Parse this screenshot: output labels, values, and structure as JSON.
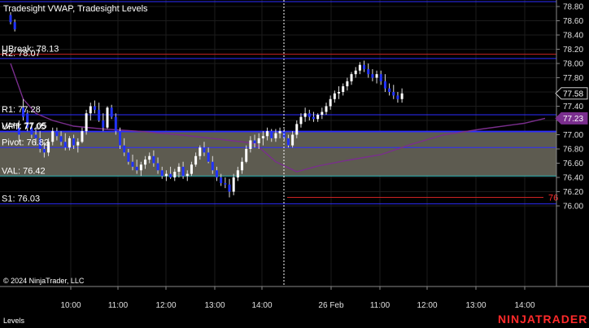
{
  "indicator_title": "Tradesight VWAP, Tradesight Levels",
  "panel_label": "Levels",
  "copyright": "© 2024 NinjaTrader, LLC",
  "brand": "NINJATRADER",
  "colors": {
    "background": "#000000",
    "value_area": "#5d5b50",
    "level_line": "#2d2dff",
    "r2_line": "#cc2222",
    "val_line": "#33bbbb",
    "vwap_line": "#7a2e8e",
    "up_candle": "#ffffff",
    "down_candle": "#2233ff",
    "brand_red": "#ff2a2a"
  },
  "chart_data": {
    "type": "candlestick",
    "ylim": [
      75.98,
      78.86
    ],
    "y_ticks": [
      "78.80",
      "78.60",
      "78.40",
      "78.20",
      "78.00",
      "77.80",
      "77.60",
      "77.40",
      "77.20",
      "77.00",
      "76.80",
      "76.60",
      "76.40",
      "76.20",
      "76.00"
    ],
    "x_ticks": [
      "10:00",
      "11:00",
      "12:00",
      "13:00",
      "14:00",
      "26 Feb",
      "11:00",
      "12:00",
      "13:00",
      "14:00"
    ],
    "levels": [
      {
        "label": "R2: 78.07",
        "value": 78.07,
        "color": "#2d2dff"
      },
      {
        "label": "R1: 77.28",
        "value": 77.28,
        "color": "#2d2dff"
      },
      {
        "label": "VAH: 77.05",
        "value": 77.05,
        "color": "#2d2dff"
      },
      {
        "label": "Pivot: 76.82",
        "value": 76.82,
        "color": "#2d2dff"
      },
      {
        "label": "VAL: 76.42",
        "value": 76.42,
        "color": "#33bbbb"
      },
      {
        "label": "S1: 76.03",
        "value": 76.03,
        "color": "#2d2dff"
      },
      {
        "label": "UPT: 77.05",
        "value": 77.04,
        "color": "#2d2dff"
      }
    ],
    "breakout": {
      "label": "UBreak: 78.13",
      "value": 78.13
    },
    "value_area": [
      76.42,
      77.05
    ],
    "price_badges": [
      {
        "label": "77.58",
        "value": 77.58
      },
      {
        "label": "77.23",
        "value": 77.23
      }
    ],
    "red_marker_label": "76",
    "red_marker_value": 76.12,
    "vwap": [
      [
        0,
        78.0
      ],
      [
        3,
        77.5
      ],
      [
        6,
        77.3
      ],
      [
        10,
        77.2
      ],
      [
        15,
        77.12
      ],
      [
        22,
        77.08
      ],
      [
        30,
        77.05
      ],
      [
        40,
        77.0
      ],
      [
        52,
        76.92
      ],
      [
        58,
        76.88
      ],
      [
        63,
        76.62
      ],
      [
        68,
        76.48
      ],
      [
        73,
        76.56
      ],
      [
        80,
        76.64
      ],
      [
        88,
        76.72
      ],
      [
        95,
        76.86
      ],
      [
        103,
        77.0
      ],
      [
        112,
        77.08
      ],
      [
        122,
        77.16
      ],
      [
        127,
        77.23
      ]
    ],
    "ohlc": [
      [
        78.68,
        78.72,
        78.55,
        78.58
      ],
      [
        78.58,
        78.62,
        78.45,
        78.48
      ],
      [
        77.1,
        77.2,
        76.9,
        77.0
      ],
      [
        77.38,
        77.5,
        77.2,
        77.25
      ],
      [
        77.3,
        77.35,
        77.05,
        77.1
      ],
      [
        77.1,
        77.15,
        76.95,
        77.0
      ],
      [
        77.0,
        77.1,
        76.85,
        76.95
      ],
      [
        76.95,
        77.05,
        76.75,
        76.8
      ],
      [
        76.8,
        76.9,
        76.68,
        76.75
      ],
      [
        76.75,
        76.95,
        76.7,
        76.9
      ],
      [
        76.9,
        77.1,
        76.85,
        77.05
      ],
      [
        77.05,
        77.1,
        76.92,
        76.98
      ],
      [
        76.98,
        77.05,
        76.85,
        76.9
      ],
      [
        76.9,
        77.02,
        76.78,
        76.82
      ],
      [
        76.82,
        76.98,
        76.78,
        76.95
      ],
      [
        76.95,
        77.0,
        76.8,
        76.85
      ],
      [
        76.85,
        76.95,
        76.75,
        76.9
      ],
      [
        76.9,
        77.1,
        76.88,
        77.05
      ],
      [
        77.05,
        77.35,
        77.0,
        77.3
      ],
      [
        77.3,
        77.45,
        77.2,
        77.4
      ],
      [
        77.4,
        77.48,
        77.3,
        77.35
      ],
      [
        77.35,
        77.45,
        77.18,
        77.2
      ],
      [
        77.2,
        77.3,
        77.05,
        77.1
      ],
      [
        77.1,
        77.4,
        77.08,
        77.38
      ],
      [
        77.38,
        77.42,
        77.22,
        77.25
      ],
      [
        77.25,
        77.3,
        77.0,
        77.05
      ],
      [
        77.05,
        77.1,
        76.8,
        76.85
      ],
      [
        76.85,
        76.95,
        76.7,
        76.75
      ],
      [
        76.75,
        76.8,
        76.58,
        76.62
      ],
      [
        76.62,
        76.72,
        76.5,
        76.55
      ],
      [
        76.55,
        76.65,
        76.45,
        76.5
      ],
      [
        76.5,
        76.62,
        76.42,
        76.58
      ],
      [
        76.58,
        76.7,
        76.52,
        76.65
      ],
      [
        76.65,
        76.75,
        76.6,
        76.7
      ],
      [
        76.7,
        76.78,
        76.55,
        76.6
      ],
      [
        76.6,
        76.68,
        76.45,
        76.5
      ],
      [
        76.5,
        76.55,
        76.38,
        76.42
      ],
      [
        76.42,
        76.5,
        76.35,
        76.45
      ],
      [
        76.45,
        76.55,
        76.38,
        76.4
      ],
      [
        76.4,
        76.52,
        76.35,
        76.48
      ],
      [
        76.48,
        76.6,
        76.4,
        76.55
      ],
      [
        76.55,
        76.62,
        76.38,
        76.42
      ],
      [
        76.42,
        76.5,
        76.35,
        76.45
      ],
      [
        76.45,
        76.62,
        76.42,
        76.58
      ],
      [
        76.58,
        76.75,
        76.55,
        76.7
      ],
      [
        76.7,
        76.85,
        76.65,
        76.82
      ],
      [
        76.82,
        76.9,
        76.7,
        76.75
      ],
      [
        76.75,
        76.82,
        76.6,
        76.62
      ],
      [
        76.62,
        76.7,
        76.45,
        76.5
      ],
      [
        76.5,
        76.55,
        76.35,
        76.4
      ],
      [
        76.4,
        76.45,
        76.28,
        76.32
      ],
      [
        76.32,
        76.4,
        76.25,
        76.3
      ],
      [
        76.3,
        76.38,
        76.12,
        76.2
      ],
      [
        76.2,
        76.45,
        76.15,
        76.4
      ],
      [
        76.4,
        76.55,
        76.35,
        76.5
      ],
      [
        76.5,
        76.68,
        76.45,
        76.62
      ],
      [
        76.62,
        76.85,
        76.6,
        76.8
      ],
      [
        76.8,
        76.98,
        76.75,
        76.92
      ],
      [
        76.92,
        77.0,
        76.82,
        76.88
      ],
      [
        76.88,
        77.02,
        76.8,
        76.95
      ],
      [
        76.95,
        77.05,
        76.85,
        76.98
      ],
      [
        76.98,
        77.1,
        76.92,
        77.05
      ],
      [
        77.05,
        77.08,
        76.9,
        76.95
      ],
      [
        76.95,
        77.08,
        76.9,
        77.02
      ],
      [
        77.02,
        77.1,
        76.95,
        77.05
      ],
      [
        77.05,
        77.08,
        76.92,
        76.95
      ],
      [
        76.95,
        77.0,
        76.82,
        76.85
      ],
      [
        76.85,
        77.05,
        76.82,
        77.0
      ],
      [
        77.0,
        77.2,
        76.95,
        77.15
      ],
      [
        77.15,
        77.3,
        77.1,
        77.25
      ],
      [
        77.25,
        77.38,
        77.18,
        77.3
      ],
      [
        77.3,
        77.35,
        77.2,
        77.25
      ],
      [
        77.25,
        77.32,
        77.18,
        77.22
      ],
      [
        77.22,
        77.3,
        77.18,
        77.28
      ],
      [
        77.28,
        77.38,
        77.22,
        77.32
      ],
      [
        77.32,
        77.45,
        77.28,
        77.4
      ],
      [
        77.4,
        77.55,
        77.35,
        77.5
      ],
      [
        77.5,
        77.62,
        77.45,
        77.58
      ],
      [
        77.58,
        77.68,
        77.5,
        77.6
      ],
      [
        77.6,
        77.72,
        77.55,
        77.68
      ],
      [
        77.68,
        77.8,
        77.62,
        77.75
      ],
      [
        77.75,
        77.88,
        77.7,
        77.85
      ],
      [
        77.85,
        77.95,
        77.8,
        77.9
      ],
      [
        77.9,
        78.02,
        77.85,
        77.98
      ],
      [
        77.98,
        78.04,
        77.88,
        77.92
      ],
      [
        77.92,
        78.0,
        77.8,
        77.85
      ],
      [
        77.85,
        77.92,
        77.75,
        77.8
      ],
      [
        77.8,
        77.9,
        77.72,
        77.85
      ],
      [
        77.85,
        77.9,
        77.7,
        77.75
      ],
      [
        77.75,
        77.85,
        77.6,
        77.65
      ],
      [
        77.65,
        77.72,
        77.55,
        77.6
      ],
      [
        77.6,
        77.7,
        77.5,
        77.55
      ],
      [
        77.55,
        77.6,
        77.45,
        77.5
      ],
      [
        77.5,
        77.65,
        77.45,
        77.58
      ]
    ]
  }
}
